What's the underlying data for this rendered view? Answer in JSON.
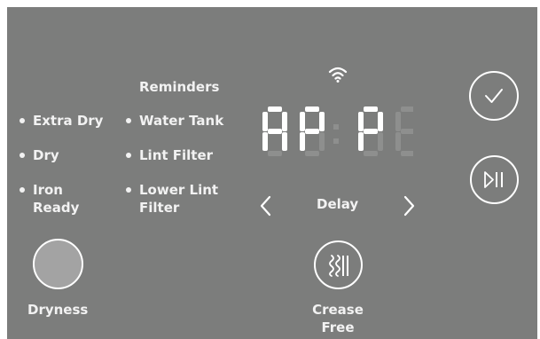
{
  "colors": {
    "panel": "#7c7d7c",
    "text": "#f2f2f2",
    "segment_dim": "#8e8f8e",
    "dryness_fill": "#a3a3a3"
  },
  "icons": [
    "wifi-icon",
    "checkmark-icon",
    "play-pause-icon",
    "chevron-left-icon",
    "chevron-right-icon",
    "crease-free-icon"
  ],
  "reminders": {
    "title": "Reminders",
    "items": [
      "Water Tank",
      "Lint Filter",
      "Lower Lint",
      "Filter"
    ]
  },
  "dryness_levels": {
    "items": [
      "Extra Dry",
      "Dry",
      "Iron",
      "Ready"
    ]
  },
  "display": {
    "text": "AP:P",
    "lit_digits": [
      "A",
      "P",
      "P"
    ]
  },
  "delay": {
    "label": "Delay"
  },
  "dryness": {
    "label": "Dryness"
  },
  "crease_free": {
    "line1": "Crease",
    "line2": "Free"
  }
}
